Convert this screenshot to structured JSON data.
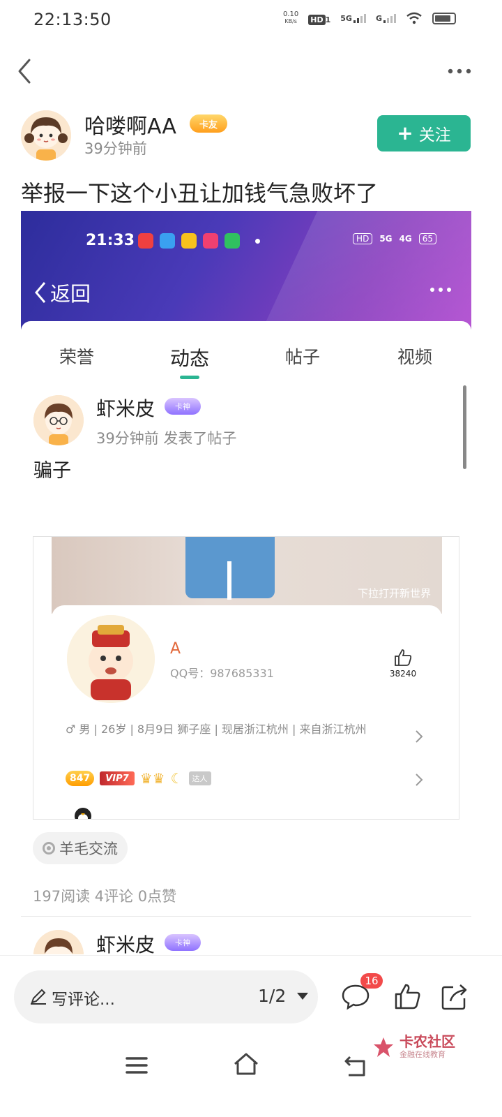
{
  "status_bar": {
    "time": "22:13:50",
    "net_speed": "0.10",
    "net_unit": "KB/s",
    "hd": "HD",
    "hd_sub": "1",
    "sig1": "5G",
    "sig2": "G"
  },
  "post": {
    "author": "哈喽啊AA",
    "author_badge": "卡友",
    "time_ago": "39分钟前",
    "follow_label": "关注",
    "title": "举报一下这个小丑让加钱气急败坏了"
  },
  "embedded": {
    "time": "21:33",
    "hd": "HD",
    "sig5g": "5G",
    "sig4g": "4G",
    "battery": "65",
    "back_label": "返回",
    "tabs": [
      "荣誉",
      "动态",
      "帖子",
      "视频"
    ],
    "active_tab": 1,
    "user_name": "虾米皮",
    "user_badge": "卡神",
    "user_meta": "39分钟前  发表了帖子",
    "user_text": "骗子",
    "inner": {
      "hint": "下拉打开新世界",
      "name": "A",
      "qq": "QQ号：987685331",
      "likes": "38240",
      "info": "♂ 男 | 26岁 | 8月9日 狮子座 | 现居浙江杭州 | 来自浙江杭州",
      "coin": "847",
      "vip": "VIP7",
      "daren": "达人"
    },
    "tag": "羊毛交流",
    "stats": "197阅读 4评论 0点赞",
    "next_user_name": "虾米皮",
    "next_user_badge": "卡神"
  },
  "bottom": {
    "comment_placeholder": "写评论...",
    "page_indicator": "1/2",
    "comment_count": "16",
    "watermark_title": "卡农社区",
    "watermark_sub": "金融在线教育"
  },
  "colors": {
    "accent": "#2bb592",
    "badge_red": "#f24a4a"
  }
}
